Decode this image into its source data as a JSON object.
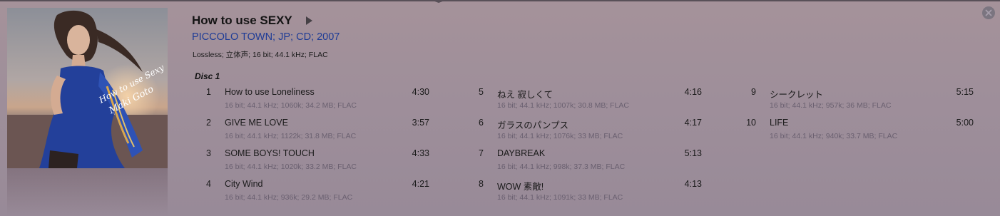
{
  "album": {
    "title": "How to use SEXY",
    "subtitle": "PICCOLO TOWN; JP; CD; 2007",
    "format": "Lossless; 立体声; 16 bit; 44.1 kHz; FLAC",
    "disc_label": "Disc 1",
    "artwork_text_1": "How to use Sexy",
    "artwork_text_2": "Maki Goto"
  },
  "icons": {
    "play": "play-icon",
    "close": "close-icon"
  },
  "colors": {
    "background": "#a5929a",
    "subtitle": "#1f3c96",
    "info": "#6a6070"
  },
  "tracks": [
    {
      "num": "1",
      "title": "How to use Loneliness",
      "duration": "4:30",
      "info": "16 bit; 44.1 kHz; 1060k; 34.2 MB; FLAC"
    },
    {
      "num": "2",
      "title": "GIVE ME LOVE",
      "duration": "3:57",
      "info": "16 bit; 44.1 kHz; 1122k; 31.8 MB; FLAC"
    },
    {
      "num": "3",
      "title": "SOME BOYS! TOUCH",
      "duration": "4:33",
      "info": "16 bit; 44.1 kHz; 1020k; 33.2 MB; FLAC"
    },
    {
      "num": "4",
      "title": "City Wind",
      "duration": "4:21",
      "info": "16 bit; 44.1 kHz; 936k; 29.2 MB; FLAC"
    },
    {
      "num": "5",
      "title": "ねえ 寂しくて",
      "duration": "4:16",
      "info": "16 bit; 44.1 kHz; 1007k; 30.8 MB; FLAC"
    },
    {
      "num": "6",
      "title": "ガラスのパンプス",
      "duration": "4:17",
      "info": "16 bit; 44.1 kHz; 1076k; 33 MB; FLAC"
    },
    {
      "num": "7",
      "title": "DAYBREAK",
      "duration": "5:13",
      "info": "16 bit; 44.1 kHz; 998k; 37.3 MB; FLAC"
    },
    {
      "num": "8",
      "title": "WOW 素敵!",
      "duration": "4:13",
      "info": "16 bit; 44.1 kHz; 1091k; 33 MB; FLAC"
    },
    {
      "num": "9",
      "title": "シークレット",
      "duration": "5:15",
      "info": "16 bit; 44.1 kHz; 957k; 36 MB; FLAC"
    },
    {
      "num": "10",
      "title": "LIFE",
      "duration": "5:00",
      "info": "16 bit; 44.1 kHz; 940k; 33.7 MB; FLAC"
    }
  ]
}
